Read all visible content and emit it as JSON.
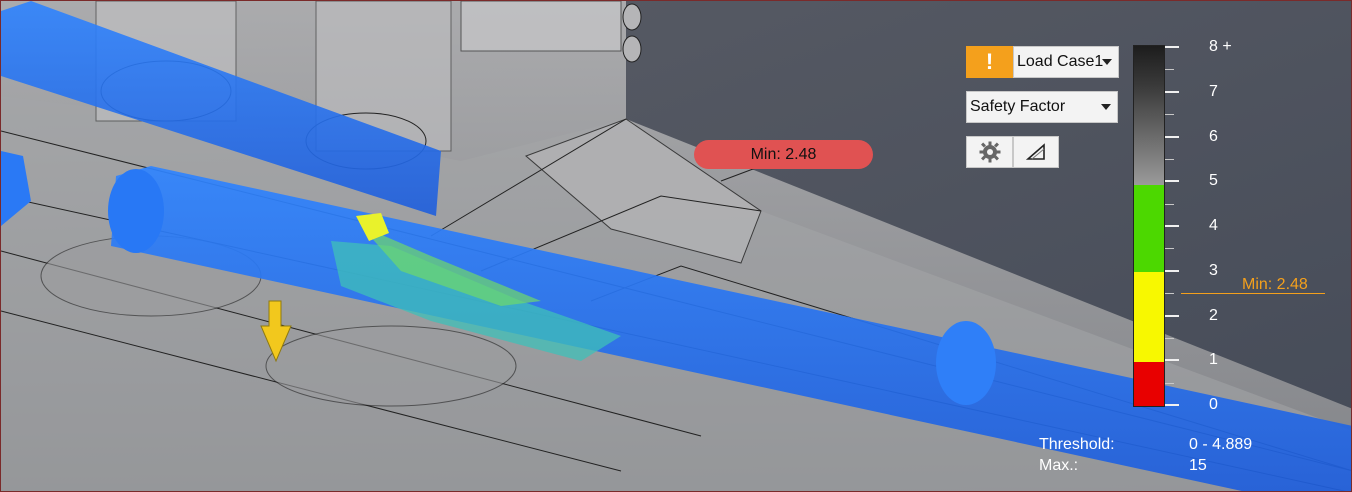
{
  "toolbar": {
    "warning_glyph": "!",
    "load_case": "Load Case1",
    "result_type": "Safety Factor",
    "settings_icon": "gear-icon",
    "deform_icon": "deformation-triangle-icon"
  },
  "callout": {
    "label": "Min: 2.48"
  },
  "legend": {
    "ticks": [
      "8 +",
      "7",
      "6",
      "5",
      "4",
      "3",
      "2",
      "1",
      "0"
    ],
    "min_marker_label": "Min: 2.48",
    "colors": {
      "red": "#e80000",
      "yellow": "#f8f800",
      "green": "#4cd800",
      "gray": "#9a9a9a",
      "accent": "#f4a01c"
    }
  },
  "info": {
    "threshold_label": "Threshold:",
    "threshold_value": "0 - 4.889",
    "max_label": "Max.:",
    "max_value": "15"
  }
}
